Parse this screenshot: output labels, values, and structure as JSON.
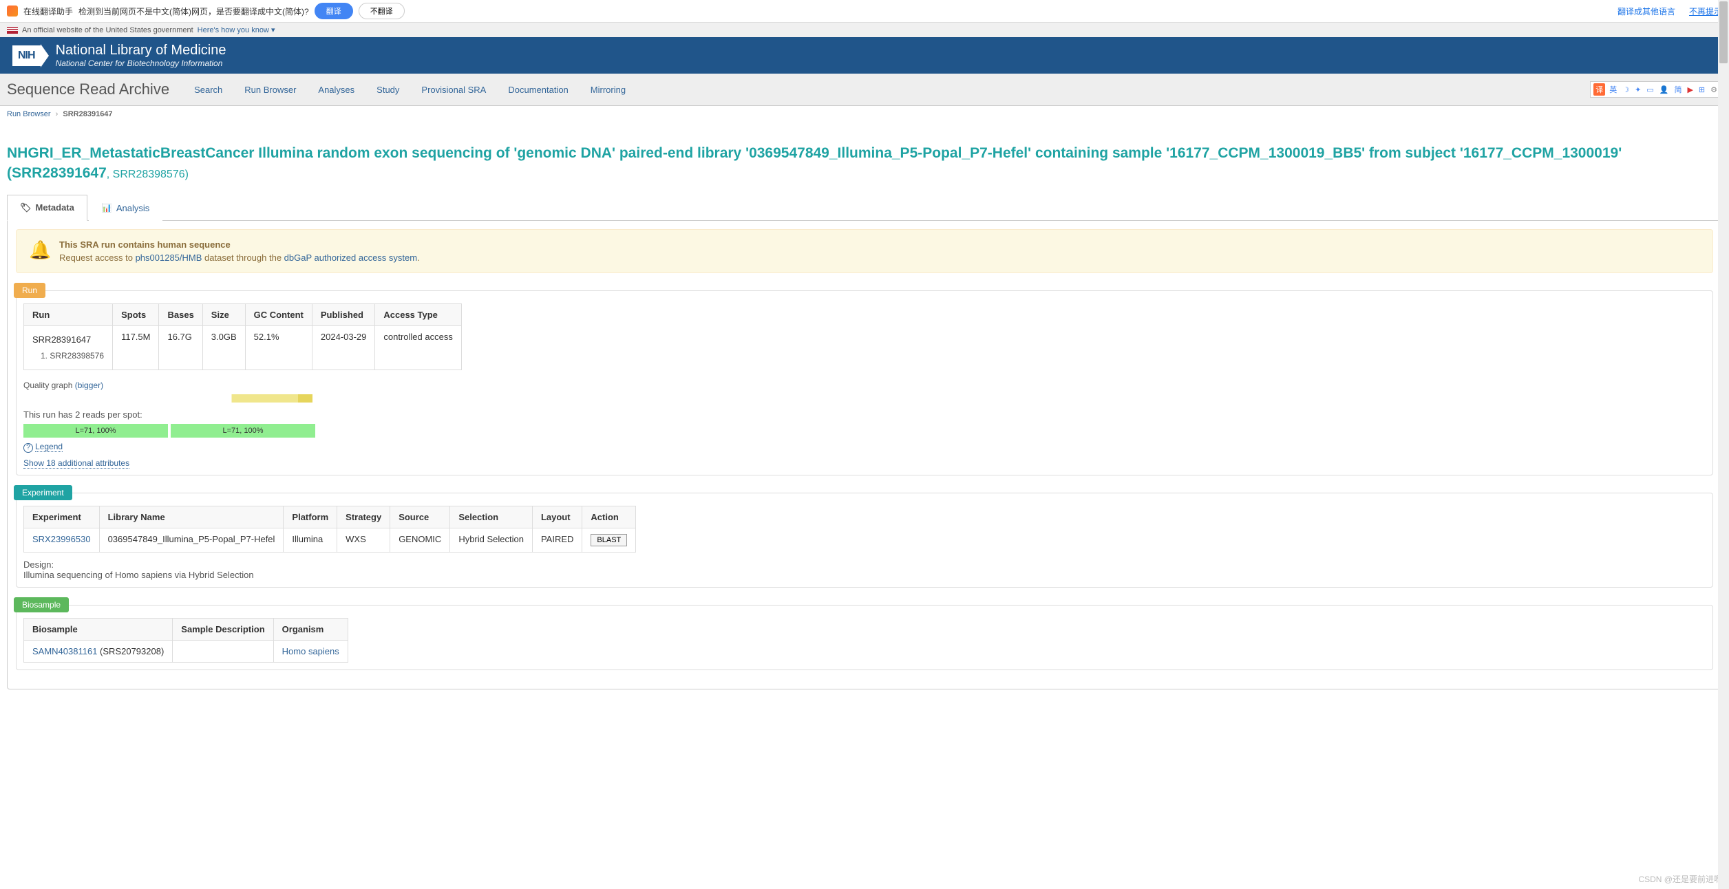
{
  "translate": {
    "helper": "在线翻译助手",
    "msg": "检测到当前网页不是中文(简体)网页，是否要翻译成中文(简体)?",
    "yes": "翻译",
    "no": "不翻译",
    "other": "翻译成其他语言",
    "never": "不再提示"
  },
  "gov": {
    "text": "An official website of the United States government",
    "link": "Here's how you know"
  },
  "nih": {
    "title": "National Library of Medicine",
    "sub": "National Center for Biotechnology Information"
  },
  "nav": {
    "title": "Sequence Read Archive",
    "items": [
      "Search",
      "Run Browser",
      "Analyses",
      "Study",
      "Provisional SRA",
      "Documentation",
      "Mirroring"
    ],
    "tools": [
      "英",
      "简"
    ]
  },
  "crumb": {
    "a": "Run Browser",
    "b": "SRR28391647"
  },
  "title": {
    "main": "NHGRI_ER_MetastaticBreastCancer Illumina random exon sequencing of 'genomic DNA' paired-end library '0369547849_Illumina_P5-Popal_P7-Hefel' containing sample '16177_CCPM_1300019_BB5' from subject '16177_CCPM_1300019' (SRR28391647",
    "sub": ", SRR28398576)"
  },
  "tabs": {
    "meta": "Metadata",
    "analysis": "Analysis"
  },
  "alert": {
    "t1": "This SRA run contains human sequence",
    "t2a": "Request access to ",
    "link1": "phs001285/HMB",
    "t2b": " dataset through the ",
    "link2": "dbGaP authorized access system",
    "t2c": "."
  },
  "run": {
    "label": "Run",
    "headers": [
      "Run",
      "Spots",
      "Bases",
      "Size",
      "GC Content",
      "Published",
      "Access Type"
    ],
    "row": {
      "run": "SRR28391647",
      "sub": "1. SRR28398576",
      "spots": "117.5M",
      "bases": "16.7G",
      "size": "3.0GB",
      "gc": "52.1%",
      "pub": "2024-03-29",
      "access": "controlled access"
    },
    "qg": "Quality graph ",
    "qg_link": "(bigger)",
    "reads": "This run has 2 reads per spot:",
    "r1": "L=71, 100%",
    "r2": "L=71, 100%",
    "legend": "Legend",
    "showmore": "Show 18 additional attributes"
  },
  "exp": {
    "label": "Experiment",
    "headers": [
      "Experiment",
      "Library Name",
      "Platform",
      "Strategy",
      "Source",
      "Selection",
      "Layout",
      "Action"
    ],
    "row": {
      "exp": "SRX23996530",
      "lib": "0369547849_Illumina_P5-Popal_P7-Hefel",
      "plat": "Illumina",
      "strat": "WXS",
      "src": "GENOMIC",
      "sel": "Hybrid Selection",
      "lay": "PAIRED",
      "act": "BLAST"
    },
    "design_l": "Design:",
    "design": "Illumina sequencing of Homo sapiens via Hybrid Selection"
  },
  "bio": {
    "label": "Biosample",
    "headers": [
      "Biosample",
      "Sample Description",
      "Organism"
    ],
    "row": {
      "bio": "SAMN40381161",
      "suff": " (SRS20793208)",
      "org": "Homo sapiens"
    }
  },
  "watermark": "CSDN @还是要前进啊"
}
